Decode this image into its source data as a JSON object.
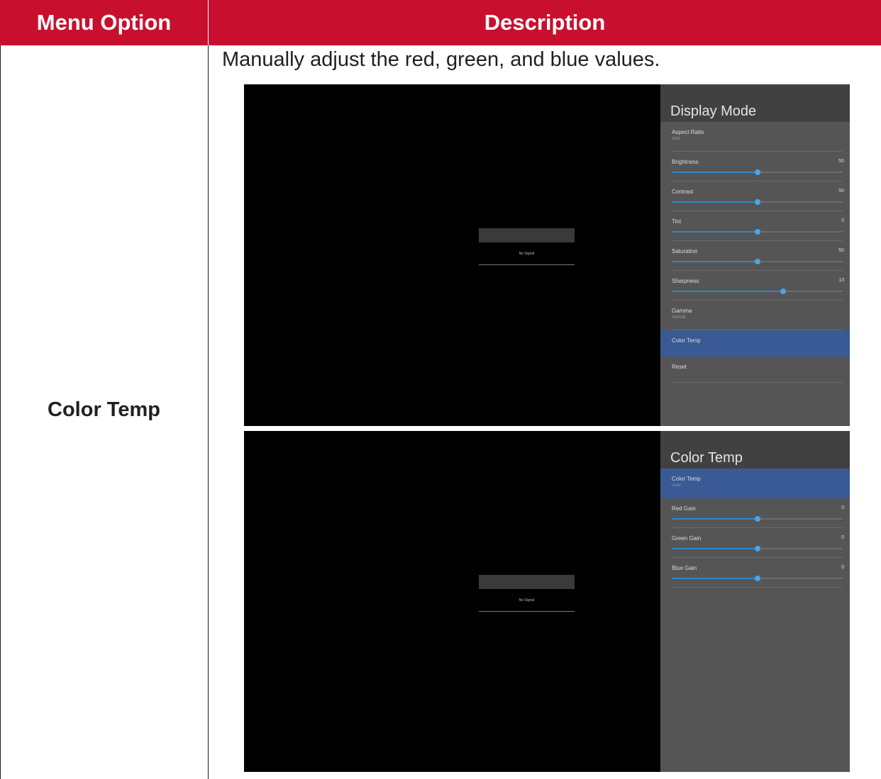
{
  "table": {
    "header_option": "Menu Option",
    "header_description": "Description",
    "option_label": "Color Temp",
    "intro": "Manually adjust the red, green, and blue values."
  },
  "colors": {
    "header_bg": "#c8102e",
    "panel_bg": "#555555",
    "selected_bg": "#3a5a96",
    "slider": "#2f86c9"
  },
  "screen1": {
    "panel_title": "Display Mode",
    "dialog_text": "No Signal",
    "items": [
      {
        "label": "Aspect Ratio",
        "sub": "Auto",
        "type": "select"
      },
      {
        "label": "Brightness",
        "value": "50",
        "level": 0.5,
        "type": "slider"
      },
      {
        "label": "Contrast",
        "value": "50",
        "level": 0.5,
        "type": "slider"
      },
      {
        "label": "Tint",
        "value": "0",
        "level": 0.5,
        "type": "slider"
      },
      {
        "label": "Saturation",
        "value": "50",
        "level": 0.5,
        "type": "slider"
      },
      {
        "label": "Sharpness",
        "value": "13",
        "level": 0.65,
        "type": "slider"
      },
      {
        "label": "Gamma",
        "sub": "Normal",
        "type": "select"
      },
      {
        "label": "Color Temp",
        "type": "link",
        "selected": true
      },
      {
        "label": "Reset",
        "type": "link"
      }
    ]
  },
  "screen2": {
    "panel_title": "Color Temp",
    "dialog_text": "No Signal",
    "items": [
      {
        "label": "Color Temp",
        "sub": "User",
        "type": "select",
        "selected": true
      },
      {
        "label": "Red Gain",
        "value": "0",
        "level": 0.5,
        "type": "slider"
      },
      {
        "label": "Green Gain",
        "value": "0",
        "level": 0.5,
        "type": "slider"
      },
      {
        "label": "Blue Gain",
        "value": "0",
        "level": 0.5,
        "type": "slider"
      }
    ]
  }
}
